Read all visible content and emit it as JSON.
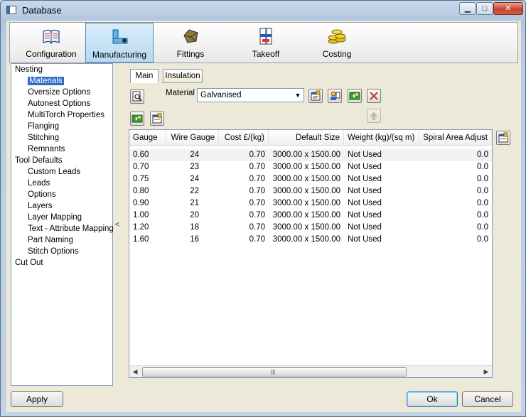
{
  "window": {
    "title": "Database",
    "buttons": {
      "minimize": "▁",
      "maximize": "□",
      "close": "✕"
    }
  },
  "toolbar": {
    "items": [
      {
        "label": "Configuration",
        "icon": "book-icon"
      },
      {
        "label": "Manufacturing",
        "icon": "pipe-icon",
        "active": true
      },
      {
        "label": "Fittings",
        "icon": "fittings-icon"
      },
      {
        "label": "Takeoff",
        "icon": "takeoff-icon"
      },
      {
        "label": "Costing",
        "icon": "coins-icon"
      }
    ]
  },
  "tree": {
    "items": [
      {
        "label": "Nesting",
        "level": 0
      },
      {
        "label": "Materials",
        "level": 1,
        "selected": true
      },
      {
        "label": "Oversize Options",
        "level": 1
      },
      {
        "label": "Autonest Options",
        "level": 1
      },
      {
        "label": "MultiTorch Properties",
        "level": 1
      },
      {
        "label": "Flanging",
        "level": 1
      },
      {
        "label": "Stitching",
        "level": 1
      },
      {
        "label": "Remnants",
        "level": 1
      },
      {
        "label": "Tool Defaults",
        "level": 0
      },
      {
        "label": "Custom Leads",
        "level": 1
      },
      {
        "label": "Leads",
        "level": 1
      },
      {
        "label": "Options",
        "level": 1
      },
      {
        "label": "Layers",
        "level": 1
      },
      {
        "label": "Layer Mapping",
        "level": 1
      },
      {
        "label": "Text - Attribute Mapping",
        "level": 1
      },
      {
        "label": "Part Naming",
        "level": 1
      },
      {
        "label": "Stitch Options",
        "level": 1
      },
      {
        "label": "Cut Out",
        "level": 0
      }
    ],
    "splitter_arrow": "<"
  },
  "tabs": [
    {
      "label": "Main",
      "active": true
    },
    {
      "label": "Insulation"
    }
  ],
  "material": {
    "label": "Material",
    "value": "Galvanised",
    "dropdown_icon": "▼"
  },
  "table": {
    "columns": [
      "Gauge",
      "Wire Gauge",
      "Cost £/(kg)",
      "Default Size",
      "Weight (kg)/(sq m)",
      "Spiral Area Adjust"
    ],
    "rows": [
      [
        "0.60",
        "24",
        "0.70",
        "3000.00 x 1500.00",
        "Not Used",
        "0.0"
      ],
      [
        "0.70",
        "23",
        "0.70",
        "3000.00 x 1500.00",
        "Not Used",
        "0.0"
      ],
      [
        "0.75",
        "24",
        "0.70",
        "3000.00 x 1500.00",
        "Not Used",
        "0.0"
      ],
      [
        "0.80",
        "22",
        "0.70",
        "3000.00 x 1500.00",
        "Not Used",
        "0.0"
      ],
      [
        "0.90",
        "21",
        "0.70",
        "3000.00 x 1500.00",
        "Not Used",
        "0.0"
      ],
      [
        "1.00",
        "20",
        "0.70",
        "3000.00 x 1500.00",
        "Not Used",
        "0.0"
      ],
      [
        "1.20",
        "18",
        "0.70",
        "3000.00 x 1500.00",
        "Not Used",
        "0.0"
      ],
      [
        "1.60",
        "16",
        "0.70",
        "3000.00 x 1500.00",
        "Not Used",
        "0.0"
      ]
    ],
    "scroll": {
      "left_arrow": "◀",
      "right_arrow": "▶",
      "grip": "|||"
    }
  },
  "buttons": {
    "apply": "Apply",
    "ok": "Ok",
    "cancel": "Cancel"
  }
}
